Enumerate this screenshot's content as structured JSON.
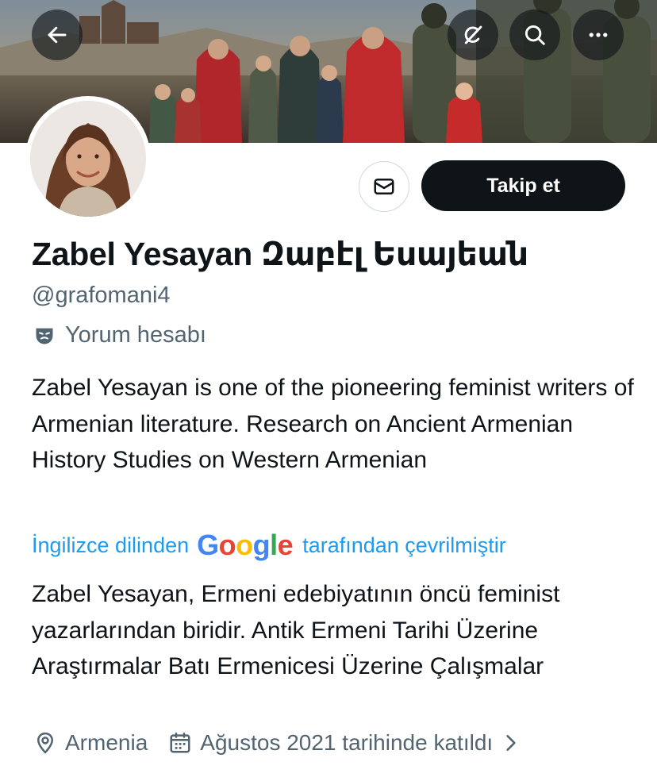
{
  "header": {
    "icons": {
      "back": "arrow-left-icon",
      "grok": "grok-icon",
      "search": "search-icon",
      "more": "more-horizontal-icon"
    }
  },
  "profile": {
    "display_name": "Zabel Yesayan Զաբէլ Եսայեան",
    "handle": "@grafomani4",
    "label": "Yorum hesabı",
    "label_icon": "theater-mask-icon",
    "bio": "Zabel Yesayan is one of the pioneering feminist writers of Armenian literature. Research on Ancient Armenian History Studies on Western Armenian",
    "translation": {
      "prefix": "İngilizce dilinden",
      "provider": "Google",
      "suffix": "tarafından çevrilmiştir",
      "text": "Zabel Yesayan, Ermeni edebiyatının öncü feminist yazarlarından biridir. Antik Ermeni Tarihi Üzerine Araştırmalar Batı Ermenicesi Üzerine Çalışmalar"
    },
    "location": "Armenia",
    "joined": "Ağustos 2021 tarihinde katıldı"
  },
  "actions": {
    "follow_label": "Takip et",
    "message_icon": "mail-icon"
  },
  "colors": {
    "text": "#0f1419",
    "secondary": "#536471",
    "link": "#1d9bf0",
    "follow_bg": "#0f1419"
  }
}
